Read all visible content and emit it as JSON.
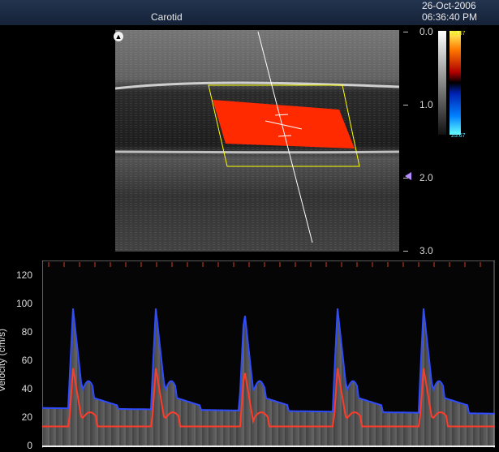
{
  "header": {
    "title": "Carotid",
    "date": "26-Oct-2006",
    "time": "06:36:40 PM"
  },
  "depth_scale": {
    "labels": [
      "0.0",
      "1.0",
      "2.0",
      "3.0"
    ]
  },
  "colorbar": {
    "max_label": "25.67",
    "min_label": "25.67"
  },
  "spectral": {
    "ylabel": "Velocity (cm/s)",
    "ticks": [
      "120",
      "100",
      "80",
      "60",
      "40",
      "20",
      "0"
    ]
  },
  "colors": {
    "doppler_box": "#ffff00",
    "flow": "#ff2a00",
    "envelope_max": "#2f4cff",
    "envelope_mean": "#ff3b2a",
    "header_bg": "#1b2a45"
  },
  "icons": {
    "probe": "probe-orientation-icon",
    "focus": "focus-marker-icon"
  }
}
